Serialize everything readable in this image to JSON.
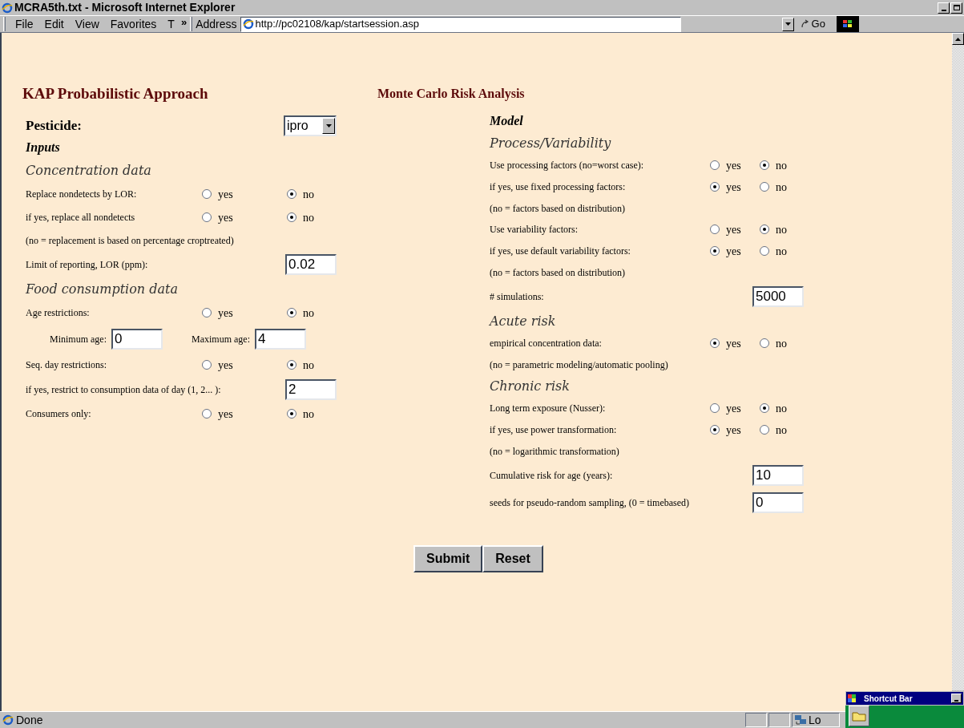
{
  "window": {
    "title": "MCRA5th.txt - Microsoft Internet Explorer"
  },
  "menu": [
    "File",
    "Edit",
    "View",
    "Favorites",
    "T"
  ],
  "menu_more": "»",
  "address": {
    "label": "Address",
    "url": "http://pc02108/kap/startsession.asp",
    "go": "Go"
  },
  "page": {
    "title": "KAP Probabilistic Approach",
    "analysis_title": "Monte Carlo Risk Analysis",
    "pesticide": {
      "label": "Pesticide:",
      "value": "ipro"
    },
    "left_rows": [
      {
        "kind": "heading",
        "text": "Inputs"
      },
      {
        "kind": "subheading",
        "text": "Concentration data"
      },
      {
        "kind": "radio",
        "label": "Replace nondetects by LOR:",
        "options": [
          {
            "label": "yes",
            "selected": false
          },
          {
            "label": "no",
            "selected": true
          }
        ]
      },
      {
        "kind": "radio",
        "label": "if yes, replace all nondetects",
        "options": [
          {
            "label": "yes",
            "selected": false
          },
          {
            "label": "no",
            "selected": true
          }
        ]
      },
      {
        "kind": "note",
        "text": "(no = replacement is based on percentage croptreated)"
      },
      {
        "kind": "input",
        "label": "Limit of reporting, LOR (ppm):",
        "value": "0.02"
      },
      {
        "kind": "subheading",
        "text": "Food consumption data"
      },
      {
        "kind": "radio",
        "label": "Age restrictions:",
        "options": [
          {
            "label": "yes",
            "selected": false
          },
          {
            "label": "no",
            "selected": true
          }
        ]
      },
      {
        "kind": "pair",
        "fields": [
          {
            "label": "Minimum age:",
            "value": "0"
          },
          {
            "label": "Maximum age:",
            "value": "4"
          }
        ]
      },
      {
        "kind": "radio",
        "label": "Seq. day restrictions:",
        "options": [
          {
            "label": "yes",
            "selected": false
          },
          {
            "label": "no",
            "selected": true
          }
        ]
      },
      {
        "kind": "input",
        "label": "if yes, restrict to consumption data of day (1, 2... ):",
        "value": "2"
      },
      {
        "kind": "radio",
        "label": "Consumers only:",
        "options": [
          {
            "label": "yes",
            "selected": false
          },
          {
            "label": "no",
            "selected": true
          }
        ]
      }
    ],
    "right_rows": [
      {
        "kind": "heading",
        "text": "Model"
      },
      {
        "kind": "subheading",
        "text": "Process/Variability"
      },
      {
        "kind": "radio",
        "label": "Use processing factors (no=worst case):",
        "options": [
          {
            "label": "yes",
            "selected": false
          },
          {
            "label": "no",
            "selected": true
          }
        ]
      },
      {
        "kind": "radio",
        "label": "if yes, use fixed processing factors:",
        "options": [
          {
            "label": "yes",
            "selected": true
          },
          {
            "label": "no",
            "selected": false
          }
        ]
      },
      {
        "kind": "note",
        "text": "(no = factors based on distribution)"
      },
      {
        "kind": "radio",
        "label": "Use variability factors:",
        "options": [
          {
            "label": "yes",
            "selected": false
          },
          {
            "label": "no",
            "selected": true
          }
        ]
      },
      {
        "kind": "radio",
        "label": "if yes, use default variability factors:",
        "options": [
          {
            "label": "yes",
            "selected": true
          },
          {
            "label": "no",
            "selected": false
          }
        ]
      },
      {
        "kind": "note",
        "text": "(no = factors based on distribution)"
      },
      {
        "kind": "input",
        "label": "# simulations:",
        "value": "5000"
      },
      {
        "kind": "subheading",
        "text": "Acute risk"
      },
      {
        "kind": "radio",
        "label": "empirical concentration data:",
        "options": [
          {
            "label": "yes",
            "selected": true
          },
          {
            "label": "no",
            "selected": false
          }
        ]
      },
      {
        "kind": "note",
        "text": "(no = parametric modeling/automatic pooling)"
      },
      {
        "kind": "subheading",
        "text": "Chronic risk"
      },
      {
        "kind": "radio",
        "label": "Long term exposure (Nusser):",
        "options": [
          {
            "label": "yes",
            "selected": false
          },
          {
            "label": "no",
            "selected": true
          }
        ]
      },
      {
        "kind": "radio",
        "label": "if yes, use power transformation:",
        "options": [
          {
            "label": "yes",
            "selected": true
          },
          {
            "label": "no",
            "selected": false
          }
        ]
      },
      {
        "kind": "note",
        "text": "(no = logarithmic transformation)"
      },
      {
        "kind": "input",
        "label": "Cumulative risk for age (years):",
        "value": "10"
      },
      {
        "kind": "input",
        "label": "seeds for pseudo-random sampling, (0 = timebased)",
        "value": "0"
      }
    ],
    "buttons": [
      "Submit",
      "Reset"
    ]
  },
  "status_bar": {
    "text": "Done",
    "zone": "Lo"
  },
  "shortcut_bar": {
    "title": "Shortcut Bar"
  }
}
